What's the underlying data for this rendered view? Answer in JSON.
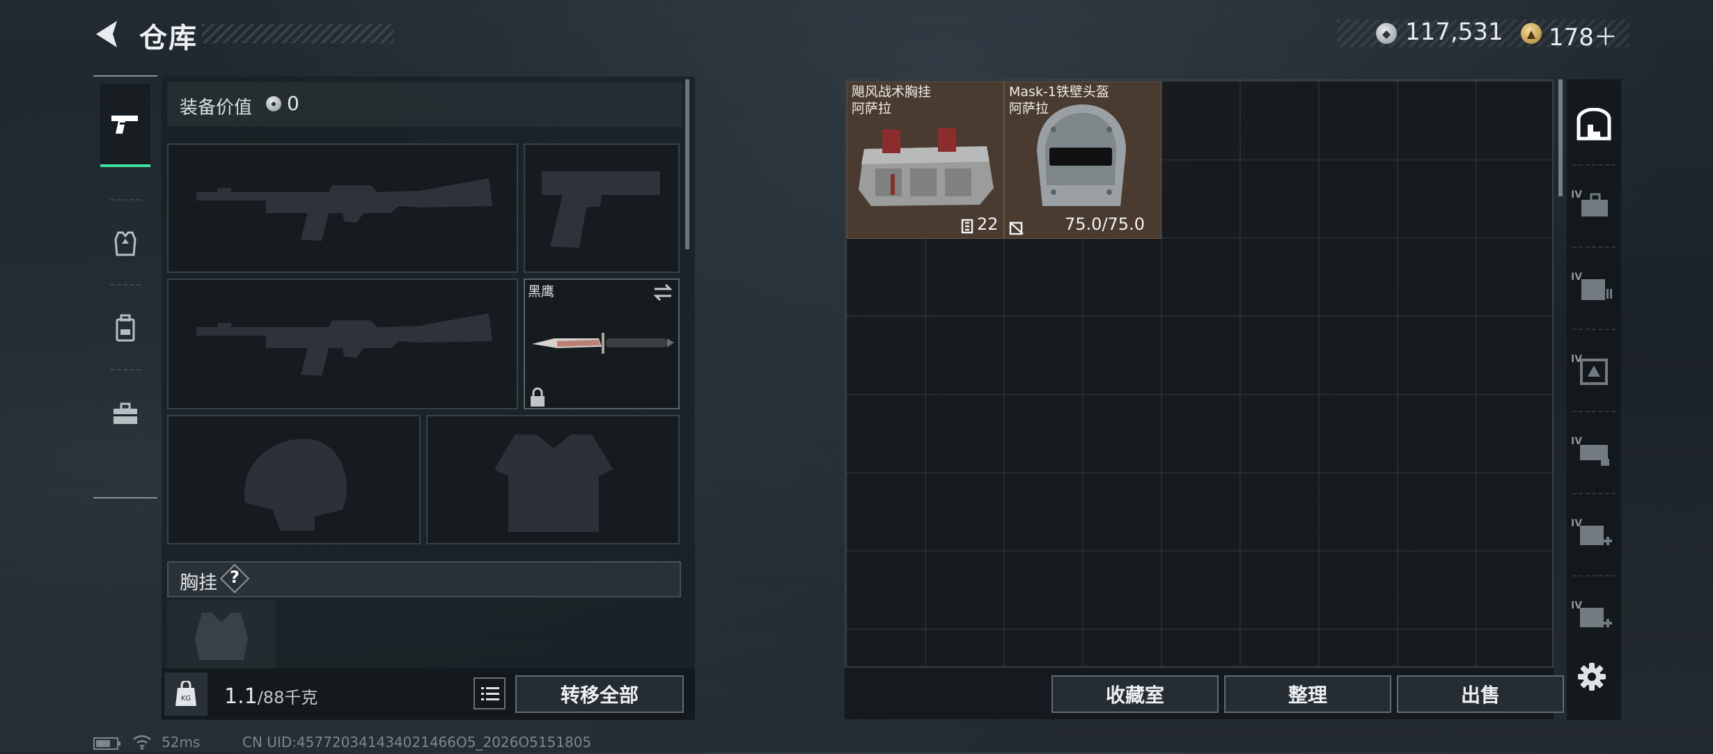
{
  "header": {
    "title": "仓库"
  },
  "currency": {
    "silver": "117,531",
    "gold": "178＋"
  },
  "left_tabs": [
    {
      "name": "weapons",
      "active": true
    },
    {
      "name": "armor",
      "active": false
    },
    {
      "name": "backpack",
      "active": false
    },
    {
      "name": "toolbox",
      "active": false
    }
  ],
  "equipment": {
    "value_label": "装备价值",
    "value": "0",
    "melee_name": "黑鹰",
    "vest_label": "胸挂",
    "help": "?"
  },
  "weight": {
    "current": "1.1",
    "max": "/88千克"
  },
  "buttons": {
    "transfer_all": "转移全部",
    "collection": "收藏室",
    "organize": "整理",
    "sell": "出售"
  },
  "storage": {
    "items": [
      {
        "name": "飓风战术胸挂",
        "map": "阿萨拉",
        "tag": "22"
      },
      {
        "name": "Mask-1铁壁头盔",
        "map": "阿萨拉",
        "tag": "75.0/75.0"
      }
    ]
  },
  "categories": {
    "tier_label": "IV"
  },
  "status": {
    "ping": "52ms",
    "uid": "CN UID:457720341434021466O5_2026O5151805"
  }
}
